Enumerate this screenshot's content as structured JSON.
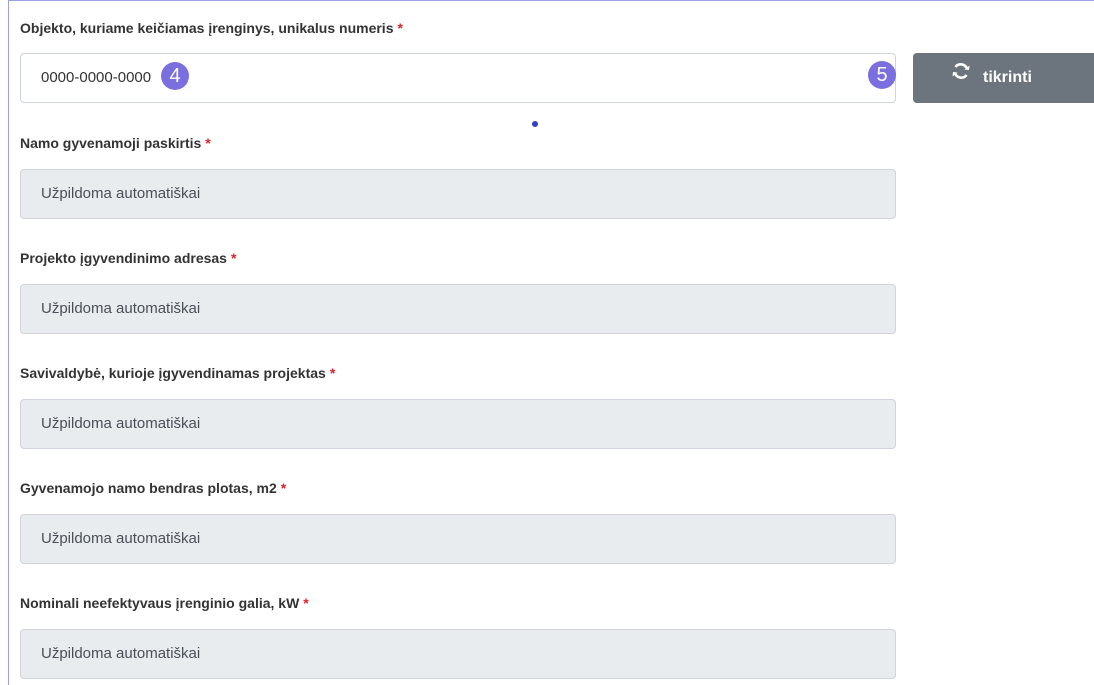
{
  "form": {
    "object_number": {
      "label": "Objekto, kuriame keičiamas įrenginys, unikalus numeris",
      "required_mark": "*",
      "value": "0000-0000-0000",
      "badge": "4"
    },
    "check_button": {
      "badge": "5",
      "label": "tikrinti",
      "icon": "refresh-icon"
    },
    "purpose": {
      "label": "Namo gyvenamoji paskirtis",
      "required_mark": "*",
      "placeholder": "Užpildoma automatiškai"
    },
    "address": {
      "label": "Projekto įgyvendinimo adresas",
      "required_mark": "*",
      "placeholder": "Užpildoma automatiškai"
    },
    "municipality": {
      "label": "Savivaldybė, kurioje įgyvendinamas projektas",
      "required_mark": "*",
      "placeholder": "Užpildoma automatiškai"
    },
    "area": {
      "label": "Gyvenamojo namo bendras plotas, m2",
      "required_mark": "*",
      "placeholder": "Užpildoma automatiškai"
    },
    "power": {
      "label": "Nominali neefektyvaus įrenginio galia, kW",
      "required_mark": "*",
      "placeholder": "Užpildoma automatiškai"
    }
  },
  "colors": {
    "accent_badge": "#7b6fe0",
    "button_bg": "#6c757d",
    "readonly_bg": "#e9ecef",
    "required": "#e0202a"
  }
}
